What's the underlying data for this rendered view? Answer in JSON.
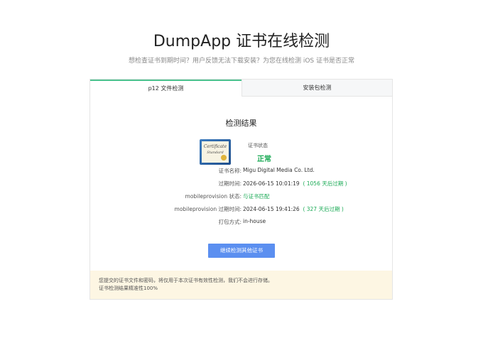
{
  "header": {
    "title": "DumpApp 证书在线检测",
    "subtitle": "想检查证书到期时间？用户反馈无法下载安装？为您在线检测 iOS 证书是否正常"
  },
  "tabs": [
    {
      "label": "p12 文件检测",
      "active": true
    },
    {
      "label": "安装包检测",
      "active": false
    }
  ],
  "result": {
    "title": "检测结果",
    "cert_image_text": "Certificate",
    "cert_image_sub": "Standard",
    "status_label": "证书状态",
    "status_value": "正常",
    "rows": [
      {
        "label": "证书名称:",
        "value": "Migu Digital Media Co. Ltd.",
        "extra": ""
      },
      {
        "label": "过期时间:",
        "value": "2026-06-15 10:01:19",
        "extra": "( 1056 天后过期 )"
      },
      {
        "label": "mobileprovision 状态:",
        "value": "",
        "extra": "与证书匹配"
      },
      {
        "label": "mobileprovision 过期时间:",
        "value": "2024-06-15 19:41:26",
        "extra": "( 327 天后过期 )"
      },
      {
        "label": "打包方式:",
        "value": "in-house",
        "extra": ""
      }
    ],
    "button_label": "继续检测其他证书"
  },
  "notice": {
    "line1": "您提交的证书文件和密码，将仅用于本次证书有效性检测，我们不会进行存储。",
    "line2": "证书检测结果精准性100%"
  },
  "colors": {
    "accent_green": "#1aaa55",
    "tab_active_border": "#4cc28f",
    "button_blue": "#5b8ff0",
    "notice_bg": "#fdf6e3"
  }
}
